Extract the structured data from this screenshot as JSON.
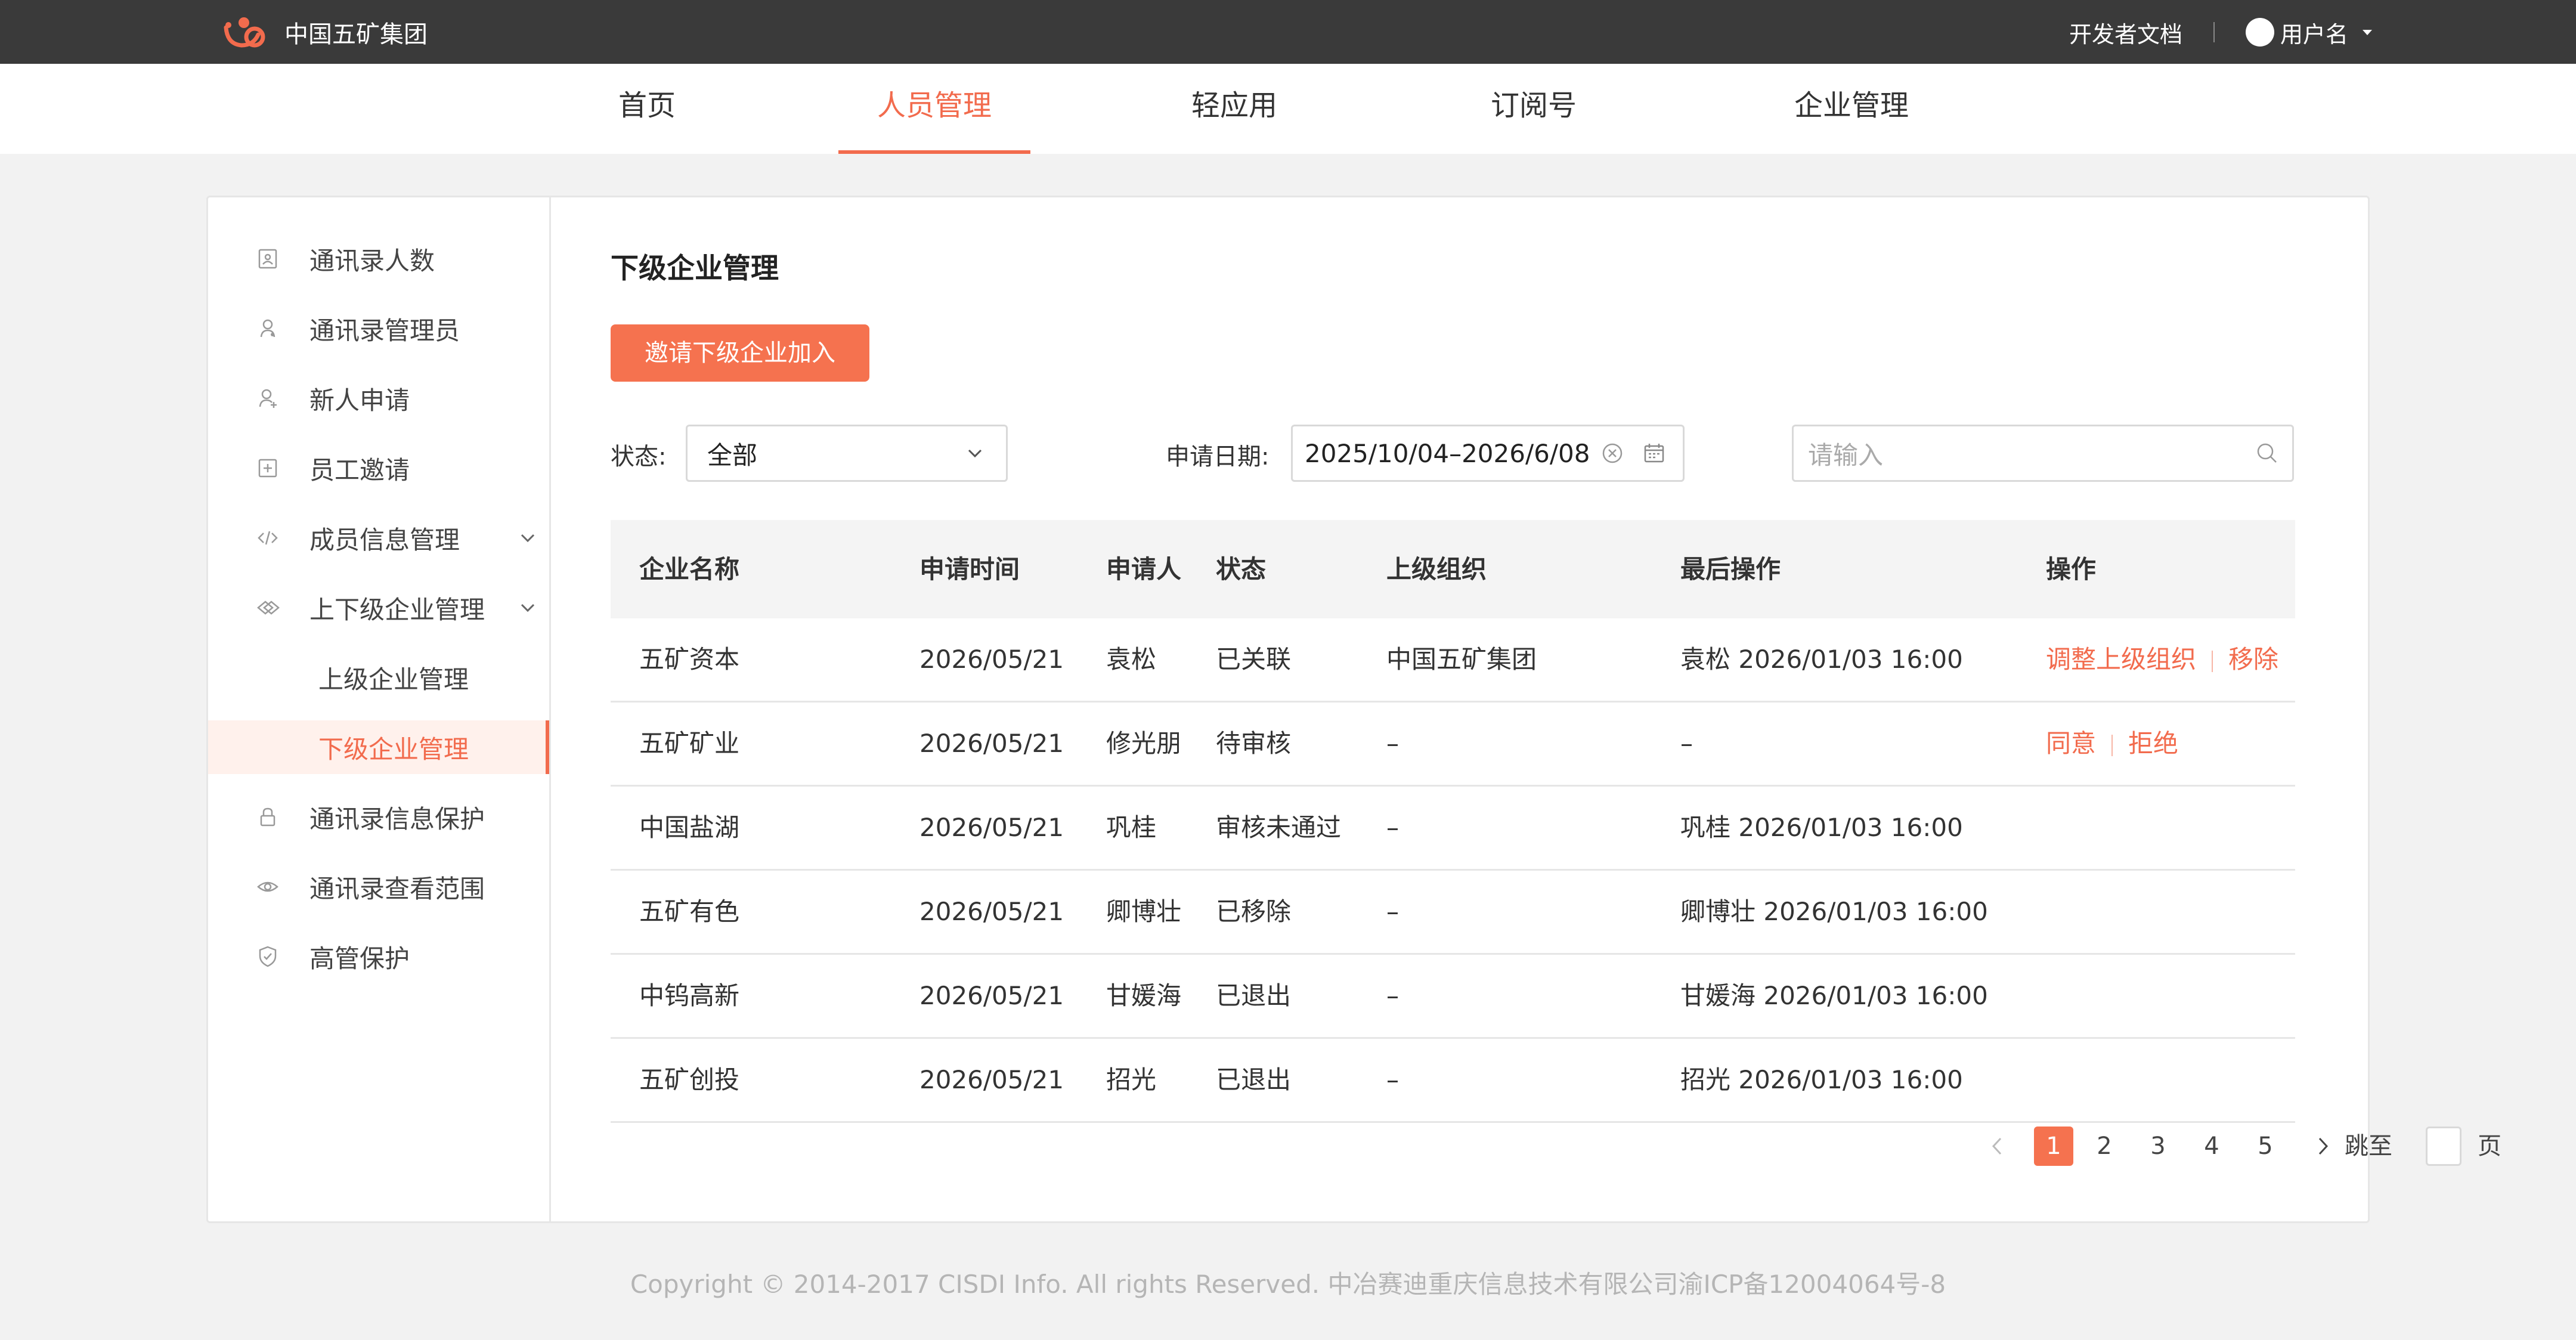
{
  "header": {
    "brand": "中国五矿集团",
    "dev_docs": "开发者文档",
    "username": "用户名"
  },
  "nav": {
    "items": [
      {
        "label": "首页",
        "active": false
      },
      {
        "label": "人员管理",
        "active": true
      },
      {
        "label": "轻应用",
        "active": false
      },
      {
        "label": "订阅号",
        "active": false
      },
      {
        "label": "企业管理",
        "active": false
      }
    ]
  },
  "sidebar": {
    "items": [
      {
        "label": "通讯录人数",
        "icon": "contact-card-icon"
      },
      {
        "label": "通讯录管理员",
        "icon": "admin-user-icon"
      },
      {
        "label": "新人申请",
        "icon": "user-add-icon"
      },
      {
        "label": "员工邀请",
        "icon": "plus-square-icon"
      },
      {
        "label": "成员信息管理",
        "icon": "code-icon",
        "expandable": true
      },
      {
        "label": "上下级企业管理",
        "icon": "layers-icon",
        "expandable": true
      },
      {
        "label": "上级企业管理",
        "sub": true
      },
      {
        "label": "下级企业管理",
        "sub": true,
        "active": true
      },
      {
        "label": "通讯录信息保护",
        "icon": "lock-icon"
      },
      {
        "label": "通讯录查看范围",
        "icon": "eye-icon"
      },
      {
        "label": "高管保护",
        "icon": "shield-icon"
      }
    ]
  },
  "main": {
    "title": "下级企业管理",
    "invite_button": "邀请下级企业加入",
    "filters": {
      "status_label": "状态:",
      "status_value": "全部",
      "date_label": "申请日期:",
      "date_value": "2025/10/04–2026/6/08",
      "search_placeholder": "请输入"
    },
    "table": {
      "columns": [
        "企业名称",
        "申请时间",
        "申请人",
        "状态",
        "上级组织",
        "最后操作",
        "操作"
      ],
      "rows": [
        {
          "name": "五矿资本",
          "date": "2026/05/21",
          "applicant": "袁松",
          "status": "已关联",
          "parent": "中国五矿集团",
          "last_op": "袁松 2026/01/03 16:00",
          "actions": [
            "调整上级组织",
            "移除"
          ]
        },
        {
          "name": "五矿矿业",
          "date": "2026/05/21",
          "applicant": "修光朋",
          "status": "待审核",
          "parent": "–",
          "last_op": "–",
          "actions": [
            "同意",
            "拒绝"
          ]
        },
        {
          "name": "中国盐湖",
          "date": "2026/05/21",
          "applicant": "巩桂",
          "status": "审核未通过",
          "parent": "–",
          "last_op": "巩桂 2026/01/03 16:00",
          "actions": []
        },
        {
          "name": "五矿有色",
          "date": "2026/05/21",
          "applicant": "卿博壮",
          "status": "已移除",
          "parent": "–",
          "last_op": "卿博壮 2026/01/03 16:00",
          "actions": []
        },
        {
          "name": "中钨高新",
          "date": "2026/05/21",
          "applicant": "甘媛海",
          "status": "已退出",
          "parent": "–",
          "last_op": "甘媛海 2026/01/03 16:00",
          "actions": []
        },
        {
          "name": "五矿创投",
          "date": "2026/05/21",
          "applicant": "招光",
          "status": "已退出",
          "parent": "–",
          "last_op": "招光 2026/01/03 16:00",
          "actions": []
        }
      ]
    },
    "pagination": {
      "pages": [
        "1",
        "2",
        "3",
        "4",
        "5"
      ],
      "current": 1,
      "jump_label": "跳至",
      "page_suffix": "页"
    }
  },
  "footer": {
    "text": "Copyright © 2014-2017 CISDI Info. All rights Reserved. 中冶赛迪重庆信息技术有限公司渝ICP备12004064号-8"
  },
  "colors": {
    "accent": "#f26b4d",
    "topbar": "#3a3a3a"
  }
}
